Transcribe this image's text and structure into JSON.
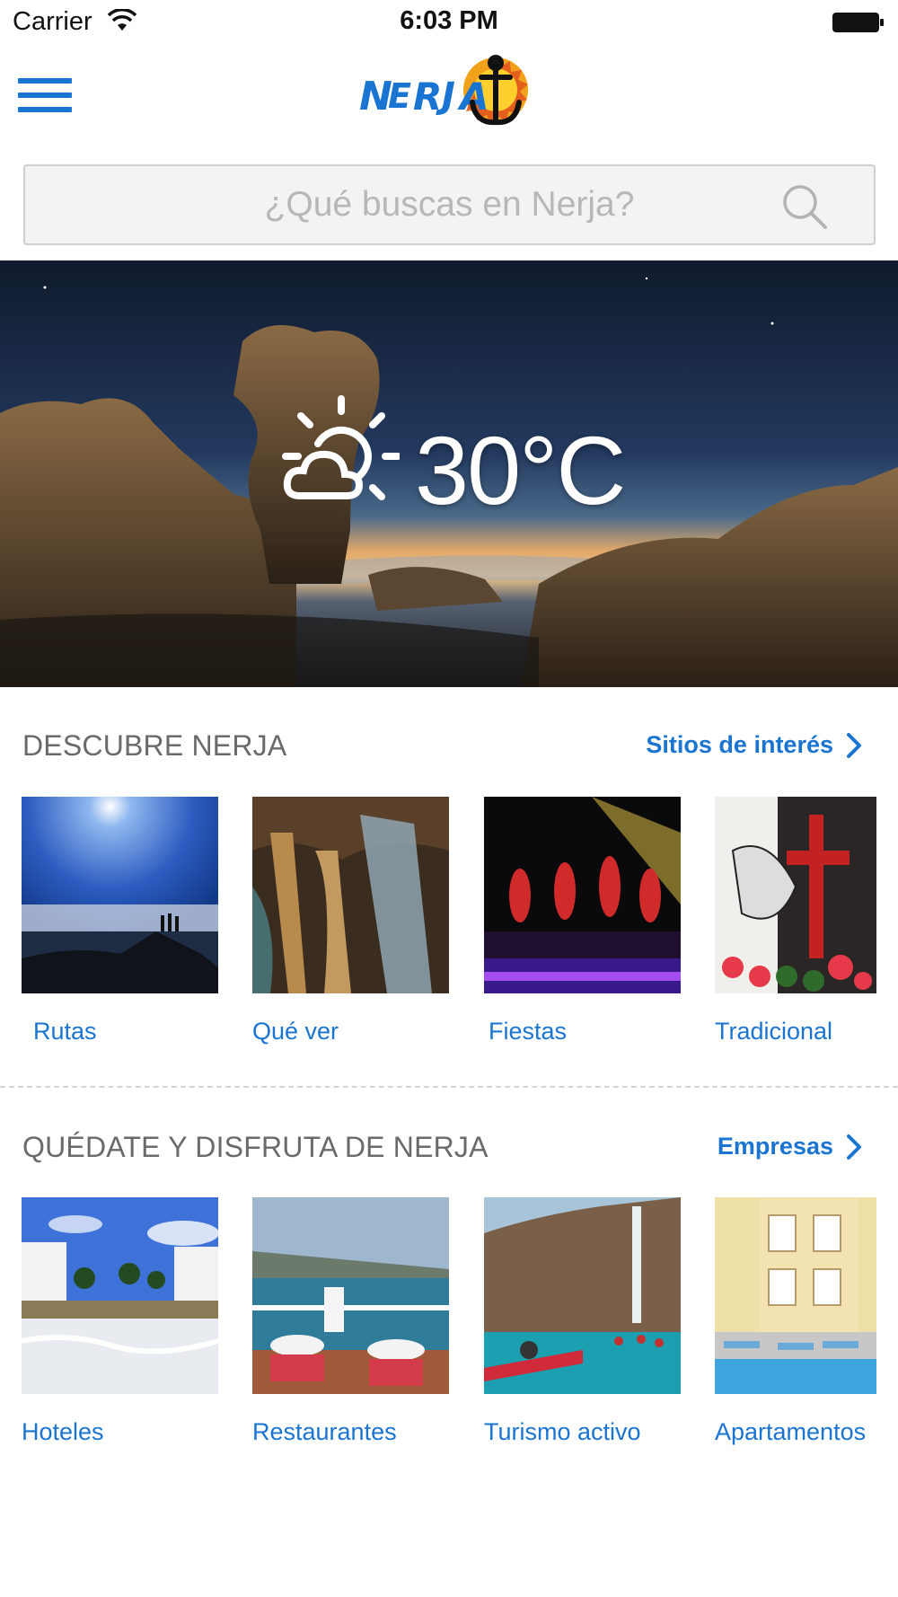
{
  "status_bar": {
    "carrier": "Carrier",
    "time": "6:03 PM"
  },
  "app": {
    "logo_text": "NERJA"
  },
  "search": {
    "placeholder": "¿Qué buscas en Nerja?"
  },
  "hero": {
    "temperature": "30°C",
    "weather_icon": "partly-cloudy-icon"
  },
  "sections": [
    {
      "title": "DESCUBRE NERJA",
      "link": "Sitios de interés",
      "tiles": [
        {
          "label": "Rutas"
        },
        {
          "label": "Qué ver"
        },
        {
          "label": "Fiestas"
        },
        {
          "label": "Tradicional"
        }
      ]
    },
    {
      "title": "QUÉDATE Y DISFRUTA DE NERJA",
      "link": "Empresas",
      "tiles": [
        {
          "label": "Hoteles"
        },
        {
          "label": "Restaurantes"
        },
        {
          "label": "Turismo activo"
        },
        {
          "label": "Apartamentos"
        }
      ]
    }
  ],
  "colors": {
    "accent": "#1a74d2",
    "title_gray": "#6a6a6a",
    "placeholder": "#b7b7b7"
  }
}
